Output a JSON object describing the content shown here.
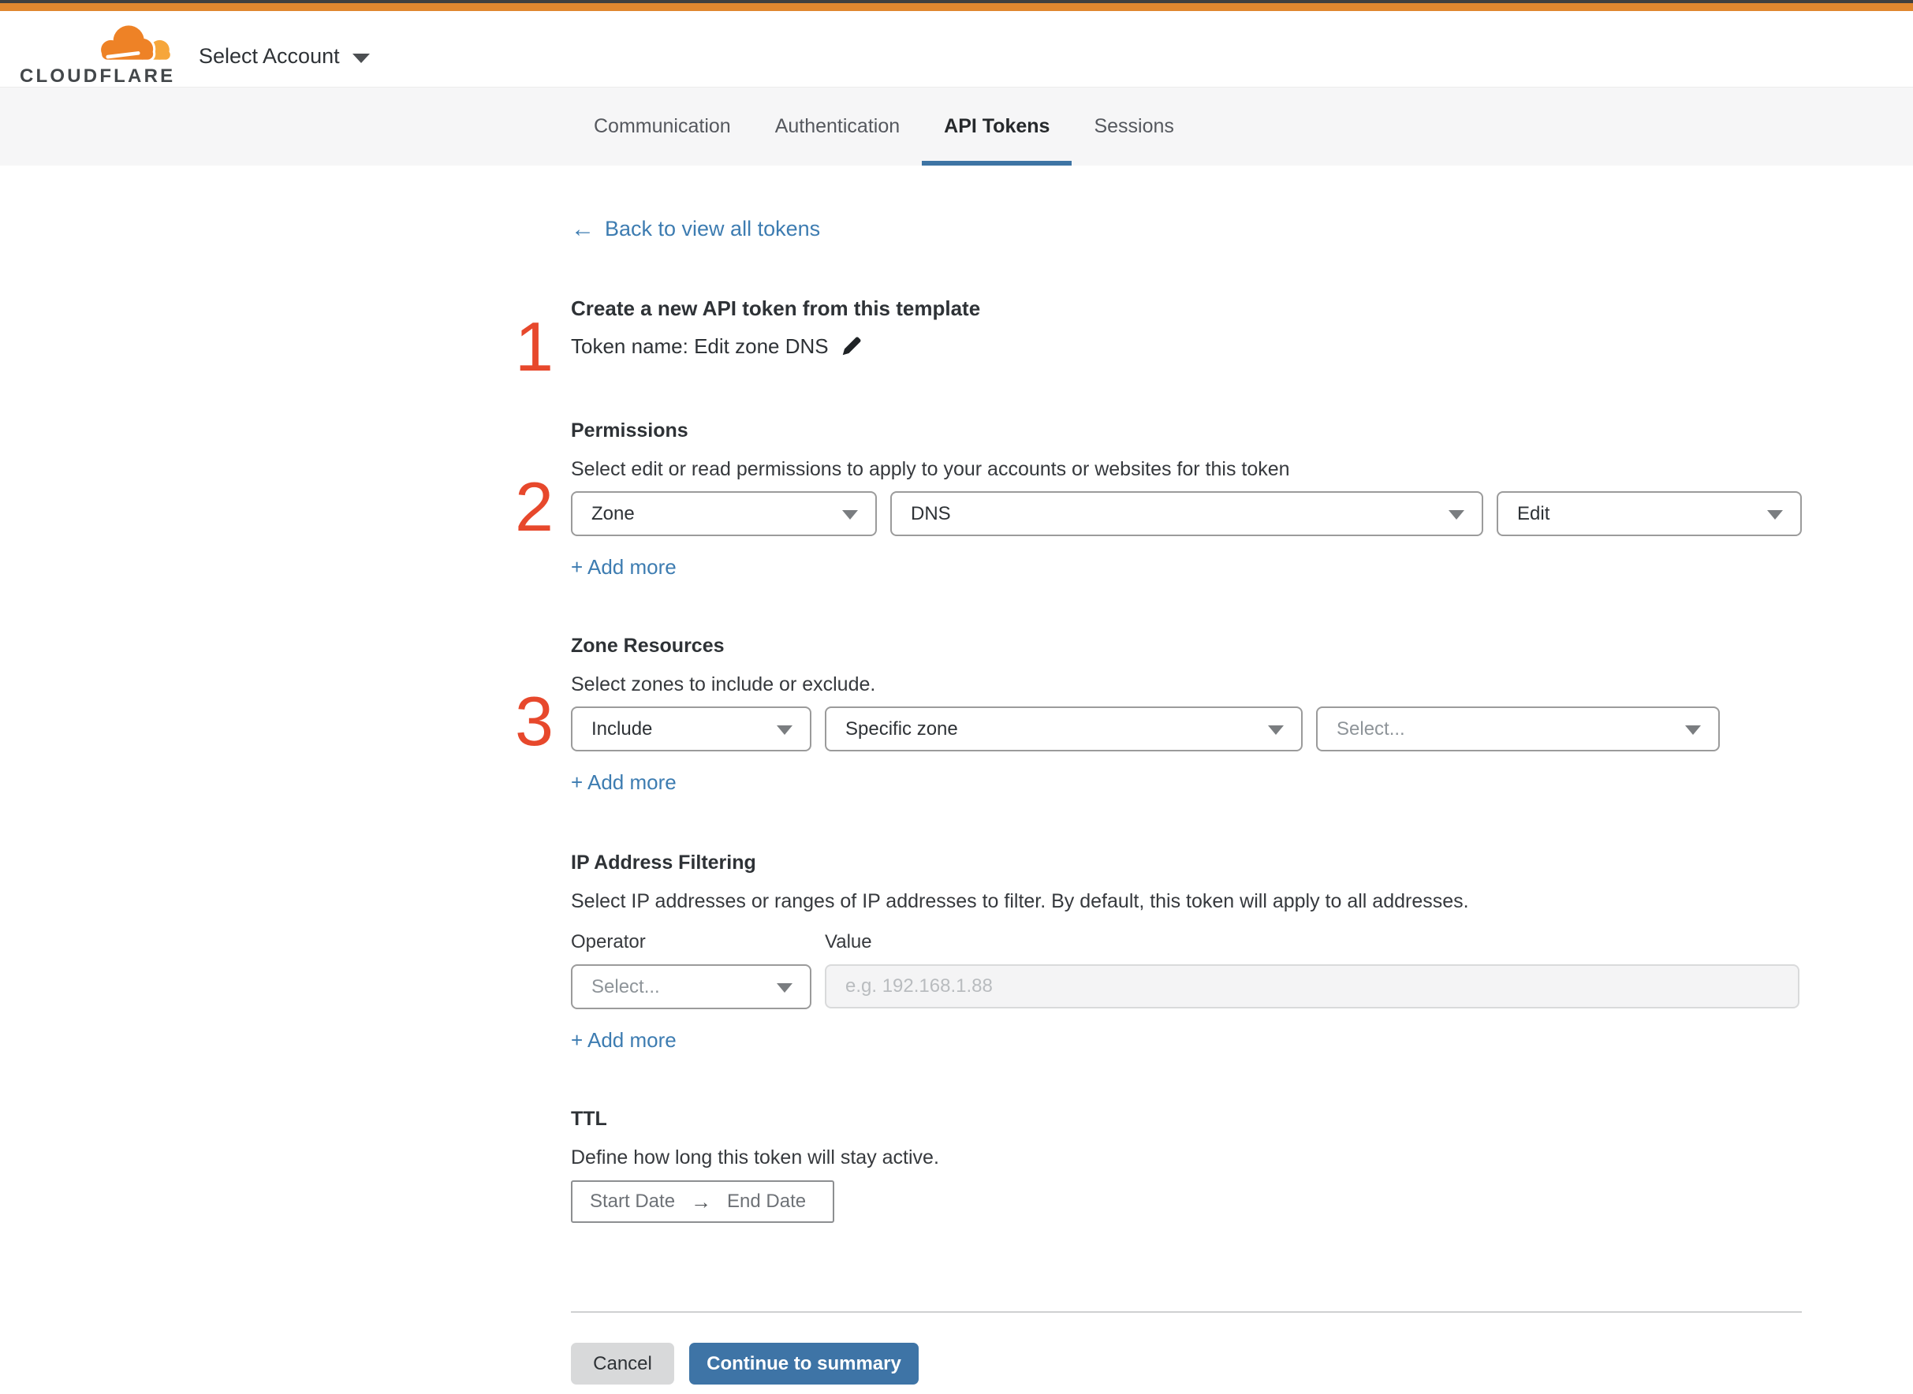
{
  "colors": {
    "accent_orange_bar": "#e0872f",
    "brand_orange": "#ee8226",
    "brand_orange_light": "#f6a63b",
    "link_blue": "#3d7cb1",
    "button_blue": "#3e74a6",
    "tab_underline_blue": "#3e74a4",
    "step_number_red": "#e7482c"
  },
  "header": {
    "brand": "CLOUDFLARE",
    "account_selector": "Select Account"
  },
  "nav": {
    "tabs": [
      {
        "label": "Communication"
      },
      {
        "label": "Authentication"
      },
      {
        "label": "API Tokens"
      },
      {
        "label": "Sessions"
      }
    ],
    "active_tab": "API Tokens"
  },
  "icons": {
    "back_arrow": "←",
    "date_range_arrow": "→"
  },
  "main": {
    "back_link": "Back to view all tokens",
    "title": "Create a new API token from this template",
    "token_name": "Token name: Edit zone DNS",
    "steps": [
      "1",
      "2",
      "3"
    ],
    "add_more": "+ Add more",
    "permissions": {
      "heading": "Permissions",
      "description": "Select edit or read permissions to apply to your accounts or websites for this token",
      "values": [
        "Zone",
        "DNS",
        "Edit"
      ]
    },
    "zone_resources": {
      "heading": "Zone Resources",
      "description": "Select zones to include or exclude.",
      "values": [
        "Include",
        "Specific zone",
        "Select..."
      ]
    },
    "ip_filtering": {
      "heading": "IP Address Filtering",
      "description": "Select IP addresses or ranges of IP addresses to filter. By default, this token will apply to all addresses.",
      "operator_label": "Operator",
      "value_label": "Value",
      "operator_value": "Select...",
      "value_placeholder": "e.g. 192.168.1.88"
    },
    "ttl": {
      "heading": "TTL",
      "description": "Define how long this token will stay active.",
      "start_label": "Start Date",
      "end_label": "End Date"
    },
    "actions": {
      "cancel": "Cancel",
      "continue": "Continue to summary"
    }
  }
}
